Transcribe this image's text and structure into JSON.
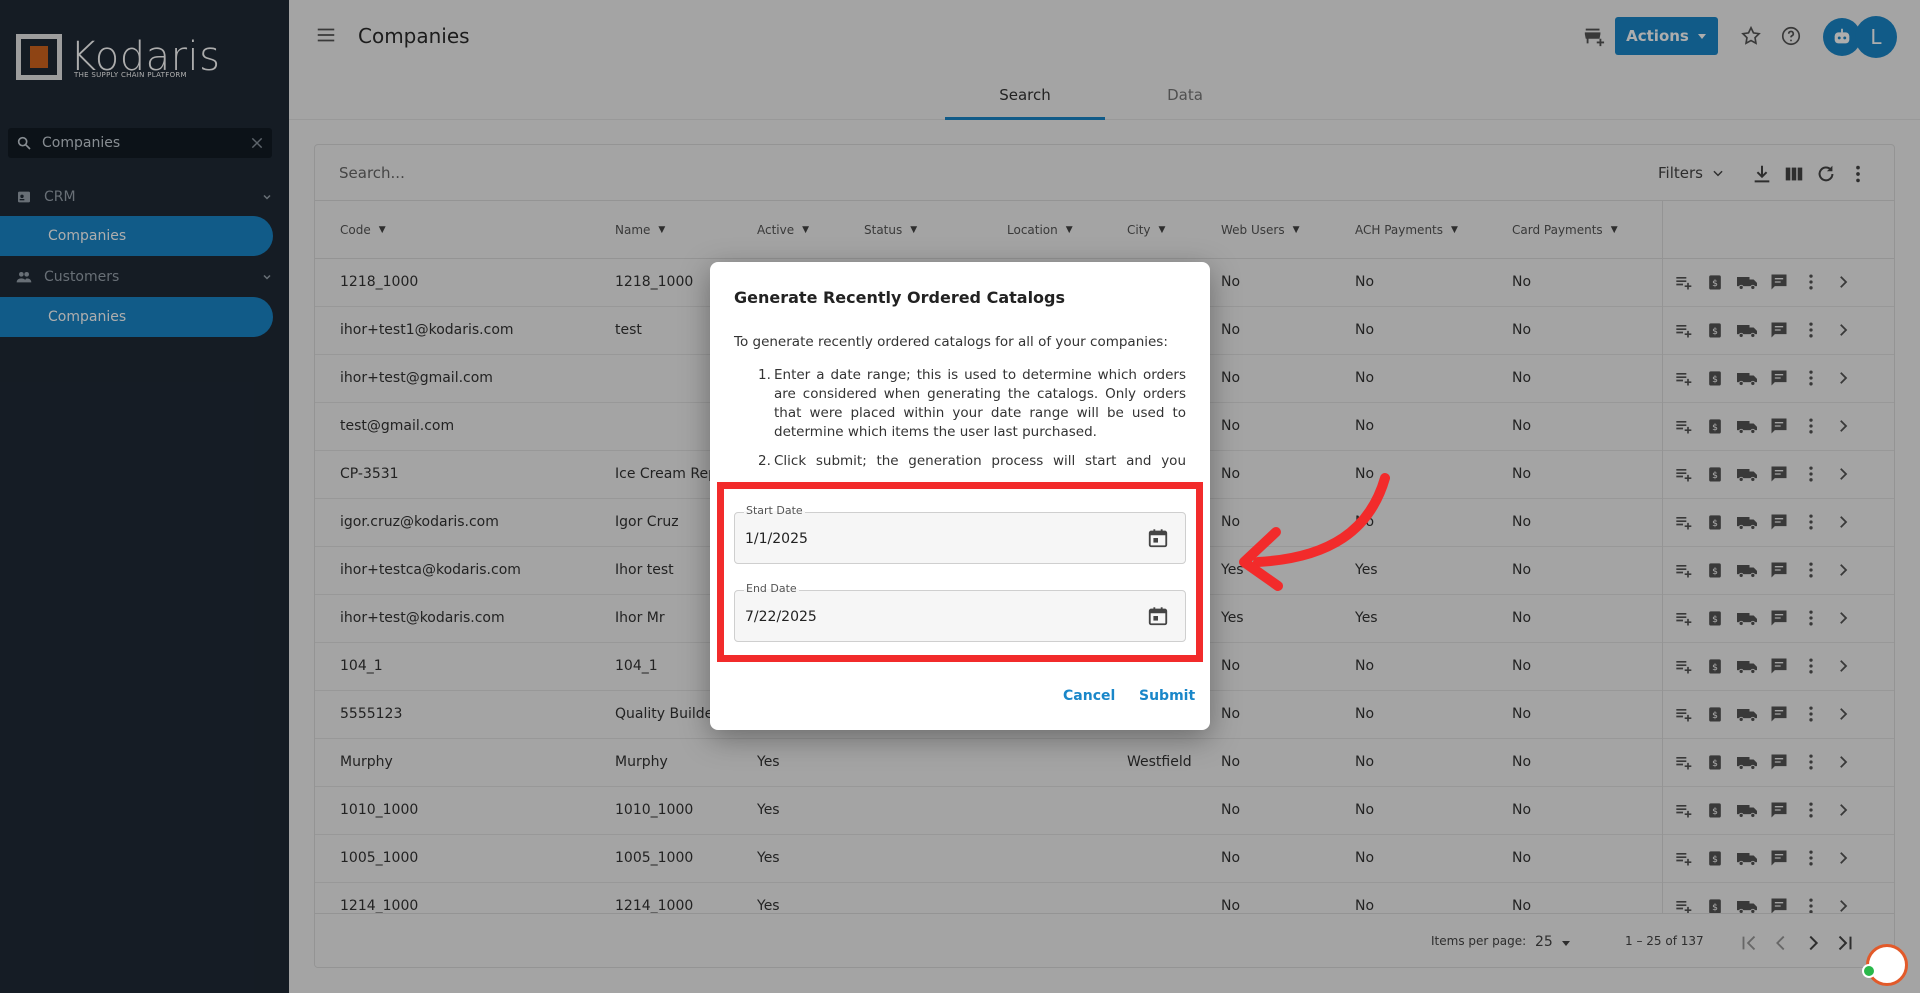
{
  "app": {
    "logo_text": "Kodaris",
    "logo_tagline": "THE SUPPLY CHAIN PLATFORM",
    "page_title": "Companies",
    "actions_label": "Actions",
    "avatar_initial": "L"
  },
  "sidebar": {
    "search_value": "Companies",
    "sections": [
      {
        "label": "CRM",
        "item": "Companies"
      },
      {
        "label": "Customers",
        "item": "Companies"
      }
    ]
  },
  "tabs": [
    "Search",
    "Data"
  ],
  "table": {
    "search_placeholder": "Search...",
    "filters_label": "Filters",
    "columns": [
      "Code",
      "Name",
      "Active",
      "Status",
      "Location",
      "City",
      "Web Users",
      "ACH Payments",
      "Card Payments"
    ],
    "rows": [
      {
        "code": "1218_1000",
        "name": "1218_1000",
        "active": "",
        "city": "",
        "web": "No",
        "ach": "No",
        "card": "No"
      },
      {
        "code": "ihor+test1@kodaris.com",
        "name": "test",
        "active": "",
        "city": "",
        "web": "No",
        "ach": "No",
        "card": "No"
      },
      {
        "code": "ihor+test@gmail.com",
        "name": "",
        "active": "",
        "city": "",
        "web": "No",
        "ach": "No",
        "card": "No"
      },
      {
        "code": "test@gmail.com",
        "name": "",
        "active": "",
        "city": "",
        "web": "No",
        "ach": "No",
        "card": "No"
      },
      {
        "code": "CP-3531",
        "name": "Ice Cream Repu",
        "active": "",
        "city": "",
        "web": "No",
        "ach": "No",
        "card": "No"
      },
      {
        "code": "igor.cruz@kodaris.com",
        "name": "Igor Cruz",
        "active": "",
        "city": "",
        "web": "No",
        "ach": "No",
        "card": "No"
      },
      {
        "code": "ihor+testca@kodaris.com",
        "name": "Ihor test",
        "active": "",
        "city": "",
        "web": "Yes",
        "ach": "Yes",
        "card": "No"
      },
      {
        "code": "ihor+test@kodaris.com",
        "name": "Ihor Mr",
        "active": "",
        "city": "",
        "web": "Yes",
        "ach": "Yes",
        "card": "No"
      },
      {
        "code": "104_1",
        "name": "104_1",
        "active": "",
        "city": "",
        "web": "No",
        "ach": "No",
        "card": "No"
      },
      {
        "code": "5555123",
        "name": "Quality Builder",
        "active": "",
        "city": "",
        "web": "No",
        "ach": "No",
        "card": "No"
      },
      {
        "code": "Murphy",
        "name": "Murphy",
        "active": "Yes",
        "city": "Westfield",
        "web": "No",
        "ach": "No",
        "card": "No"
      },
      {
        "code": "1010_1000",
        "name": "1010_1000",
        "active": "Yes",
        "city": "",
        "web": "No",
        "ach": "No",
        "card": "No"
      },
      {
        "code": "1005_1000",
        "name": "1005_1000",
        "active": "Yes",
        "city": "",
        "web": "No",
        "ach": "No",
        "card": "No"
      },
      {
        "code": "1214_1000",
        "name": "1214_1000",
        "active": "Yes",
        "city": "",
        "web": "No",
        "ach": "No",
        "card": "No"
      }
    ],
    "items_per_page_label": "Items per page:",
    "items_per_page": "25",
    "range_label": "1 – 25 of 137"
  },
  "dialog": {
    "title": "Generate Recently Ordered Catalogs",
    "intro": "To generate recently ordered catalogs for all of your companies:",
    "steps": [
      "Enter a date range; this is used to determine which orders are considered when generating the catalogs. Only orders that were placed within your date range will be used to determine which items the user last purchased.",
      "Click submit; the generation process will start and you should see the all the catalogs created within a few hours."
    ],
    "start_label": "Start Date",
    "start_value": "1/1/2025",
    "end_label": "End Date",
    "end_value": "7/22/2025",
    "cancel_label": "Cancel",
    "submit_label": "Submit"
  },
  "colors": {
    "accent": "#1a87c9",
    "sidebar_bg": "#1f2a36",
    "highlight": "#f22b2b"
  }
}
